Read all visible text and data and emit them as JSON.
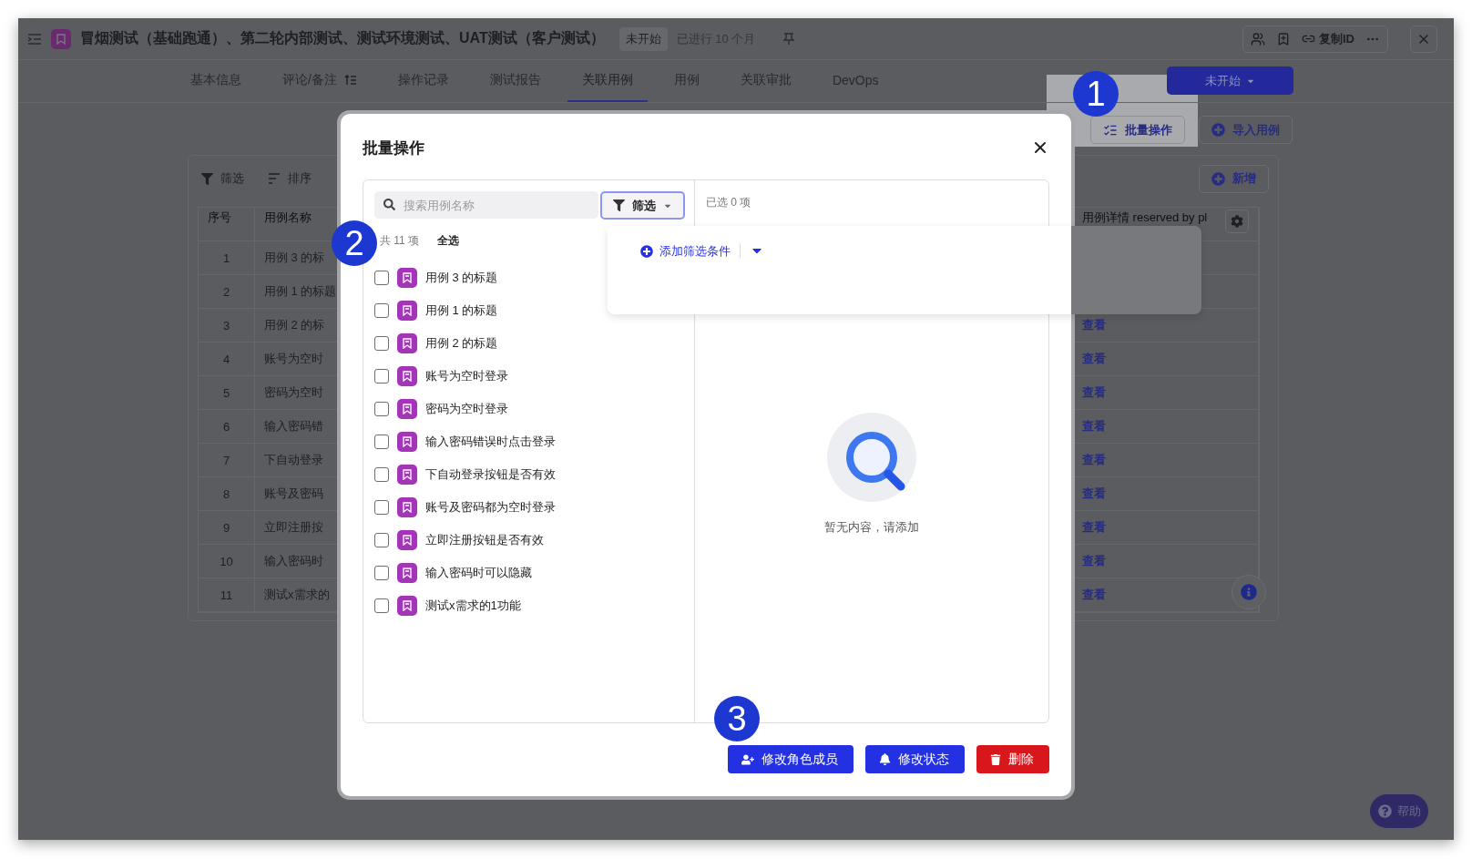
{
  "window": {
    "title": "冒烟测试（基础跑通）、第二轮内部测试、测试环境测试、UAT测试（客户测试）",
    "status": "未开始",
    "elapsed": "已进行 10 个月",
    "copy_id": "复制ID"
  },
  "tabs": [
    {
      "label": "基本信息",
      "selected": false
    },
    {
      "label": "评论/备注",
      "selected": false,
      "sort_icon": true
    },
    {
      "label": "操作记录",
      "selected": false
    },
    {
      "label": "测试报告",
      "selected": false
    },
    {
      "label": "关联用例",
      "selected": true
    },
    {
      "label": "用例",
      "selected": false
    },
    {
      "label": "关联审批",
      "selected": false
    },
    {
      "label": "DevOps",
      "selected": false
    }
  ],
  "page": {
    "status_button": "未开始",
    "batch_button": "批量操作",
    "import_button": "导入用例",
    "filter": "筛选",
    "sort": "排序",
    "add_button": "新增",
    "table": {
      "columns": [
        "序号",
        "用例名称",
        "用例详情 reserved by pl"
      ],
      "rows": [
        {
          "cells": [
            "1",
            "用例 3 的标"
          ]
        },
        {
          "cells": [
            "2",
            "用例 1 的标题"
          ]
        },
        {
          "cells": [
            "3",
            "用例 2 的标"
          ],
          "link": "查看"
        },
        {
          "cells": [
            "4",
            "账号为空时"
          ],
          "link": "查看"
        },
        {
          "cells": [
            "5",
            "密码为空时"
          ],
          "link": "查看"
        },
        {
          "cells": [
            "6",
            "输入密码错"
          ],
          "link": "查看"
        },
        {
          "cells": [
            "7",
            "下自动登录"
          ],
          "link": "查看"
        },
        {
          "cells": [
            "8",
            "账号及密码"
          ],
          "link": "查看"
        },
        {
          "cells": [
            "9",
            "立即注册按"
          ],
          "link": "查看"
        },
        {
          "cells": [
            "10",
            "输入密码时"
          ],
          "link": "查看"
        },
        {
          "cells": [
            "11",
            "测试x需求的"
          ],
          "link": "查看"
        }
      ]
    },
    "help_button": "帮助"
  },
  "dialog": {
    "title": "批量操作",
    "search": {
      "placeholder": "搜索用例名称"
    },
    "filter_button": "筛选",
    "count": "共 11 项",
    "select_all": "全选",
    "items": [
      {
        "label": "用例 3 的标题",
        "checked": false
      },
      {
        "label": "用例 1 的标题",
        "checked": false
      },
      {
        "label": "用例 2 的标题",
        "checked": false
      },
      {
        "label": "账号为空时登录",
        "checked": false
      },
      {
        "label": "密码为空时登录",
        "checked": false
      },
      {
        "label": "输入密码错误时点击登录",
        "checked": false
      },
      {
        "label": "下自动登录按钮是否有效",
        "checked": false
      },
      {
        "label": "账号及密码都为空时登录",
        "checked": false
      },
      {
        "label": "立即注册按钮是否有效",
        "checked": false
      },
      {
        "label": "输入密码时可以隐藏",
        "checked": false
      },
      {
        "label": "测试x需求的1功能",
        "checked": false
      }
    ],
    "selected_count": "已选 0 项",
    "empty_text": "暂无内容，请添加",
    "buttons": [
      {
        "label": "修改角色成员",
        "kind": "primary"
      },
      {
        "label": "修改状态",
        "kind": "primary"
      },
      {
        "label": "删除",
        "kind": "danger"
      }
    ]
  },
  "filter_popup": {
    "add_label": "添加筛选条件"
  },
  "callouts": [
    "1",
    "2",
    "3"
  ]
}
